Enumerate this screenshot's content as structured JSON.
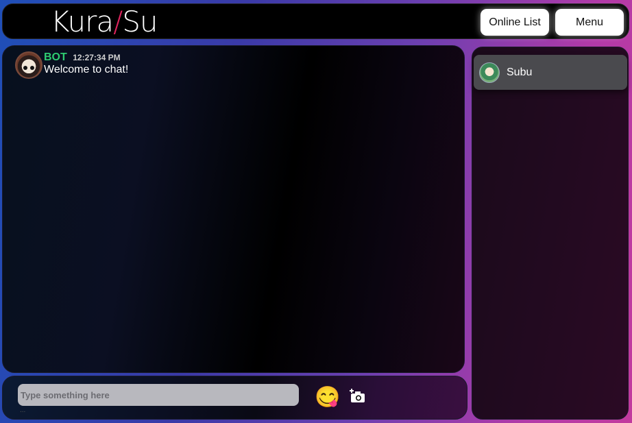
{
  "header": {
    "logo_left": "Kura",
    "logo_slash": "/",
    "logo_right": "Su",
    "online_list_label": "Online List",
    "menu_label": "Menu"
  },
  "chat": {
    "messages": [
      {
        "name": "BOT",
        "time": "12:27:34 PM",
        "text": "Welcome to chat!"
      }
    ]
  },
  "input": {
    "placeholder": "Type something here",
    "dots": "...",
    "emoji": "😋"
  },
  "online": {
    "users": [
      {
        "name": "Subu"
      }
    ]
  },
  "colors": {
    "bot_name": "#2ecc71",
    "logo_accent": "#e0245e"
  },
  "icons": {
    "emoji": "emoji-icon",
    "camera": "camera-add-icon"
  }
}
